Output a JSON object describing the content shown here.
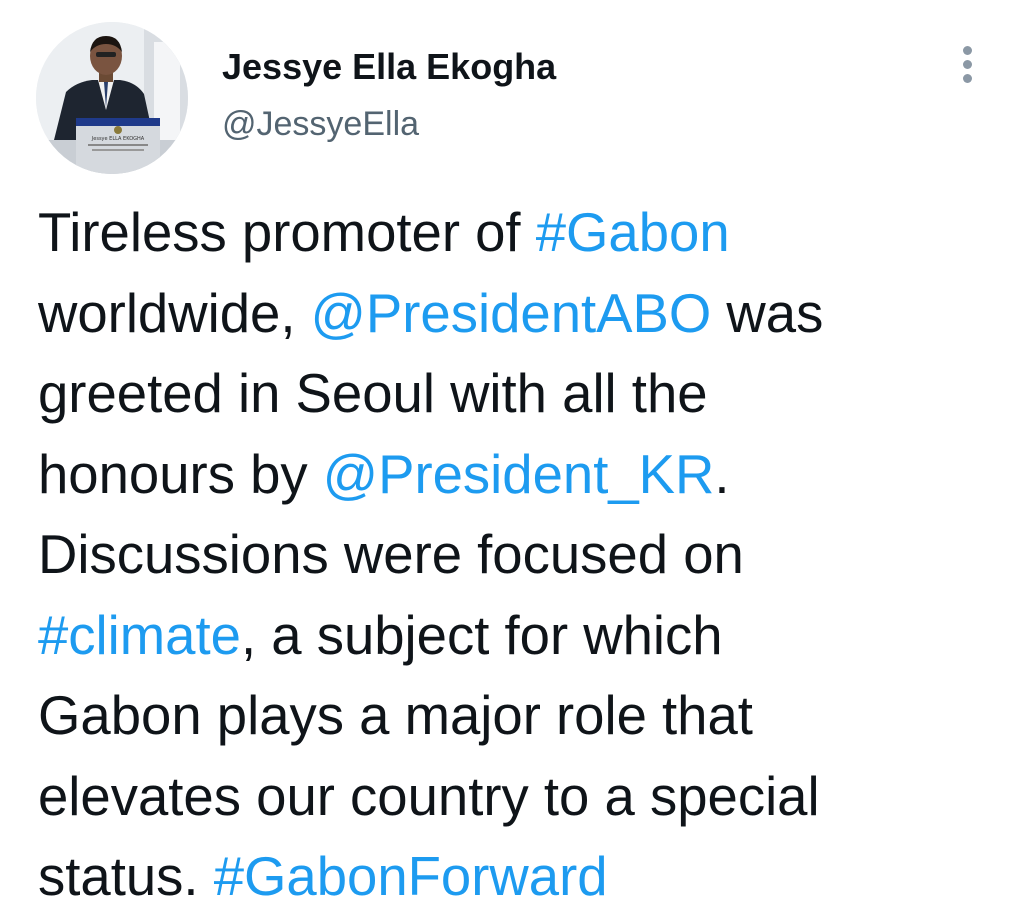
{
  "author": {
    "display_name": "Jessye Ella Ekogha",
    "handle": "@JessyeElla",
    "avatar_icon": "profile-photo-speaker-at-podium",
    "avatar_podium_sign": "Jessye ELLA EKOGHA"
  },
  "more_menu": {
    "icon": "more-vertical-icon"
  },
  "tweet": {
    "lines": [
      [
        {
          "text": "Tireless promoter of ",
          "type": "text"
        },
        {
          "text": "#Gabon",
          "type": "hashtag"
        }
      ],
      [
        {
          "text": "worldwide, ",
          "type": "text"
        },
        {
          "text": "@PresidentABO",
          "type": "mention"
        },
        {
          "text": " was",
          "type": "text"
        }
      ],
      [
        {
          "text": "greeted in Seoul with all the",
          "type": "text"
        }
      ],
      [
        {
          "text": "honours by ",
          "type": "text"
        },
        {
          "text": "@President_KR",
          "type": "mention"
        },
        {
          "text": ".",
          "type": "text"
        }
      ],
      [
        {
          "text": "Discussions were focused on",
          "type": "text"
        }
      ],
      [
        {
          "text": "#climate",
          "type": "hashtag"
        },
        {
          "text": ", a subject for which",
          "type": "text"
        }
      ],
      [
        {
          "text": "Gabon plays a major role that",
          "type": "text"
        }
      ],
      [
        {
          "text": "elevates our country to a special",
          "type": "text"
        }
      ],
      [
        {
          "text": "status. ",
          "type": "text"
        },
        {
          "text": "#GabonForward",
          "type": "hashtag"
        }
      ]
    ]
  },
  "colors": {
    "link": "#1d9bf0",
    "text": "#0f1419",
    "secondary_text": "#536471",
    "icon_gray": "#8b98a5",
    "background": "#ffffff"
  }
}
